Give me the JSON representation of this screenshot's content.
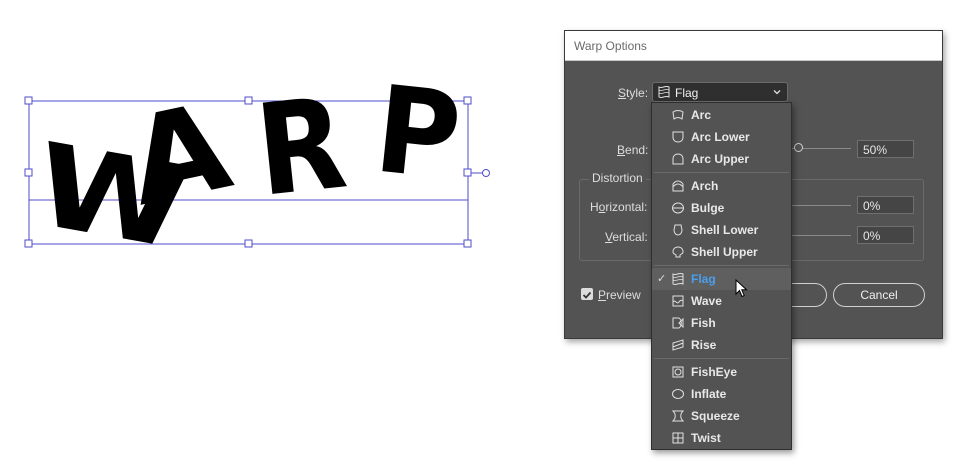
{
  "artwork": {
    "text": "WARP"
  },
  "dialog": {
    "title": "Warp Options",
    "style": {
      "label_prefix": "",
      "label_key": "S",
      "label_rest": "tyle:",
      "selected": "Flag",
      "selected_icon": "flag-style-icon"
    },
    "bend": {
      "label_key": "B",
      "label_rest": "end:",
      "value": "50%",
      "fraction": 0.75
    },
    "distortion": {
      "group_label": "Distortion",
      "horizontal": {
        "label_pre": "H",
        "label_key": "o",
        "label_rest": "rizontal:",
        "value": "0%",
        "fraction": 0.5
      },
      "vertical": {
        "label_pre": "",
        "label_key": "V",
        "label_rest": "ertical:",
        "value": "0%",
        "fraction": 0.5
      }
    },
    "preview": {
      "label_key": "P",
      "label_rest": "review",
      "checked": true
    },
    "buttons": {
      "ok": "",
      "cancel": "Cancel"
    }
  },
  "dropdown": {
    "groups": [
      [
        {
          "label": "Arc",
          "icon": "arc-style-icon"
        },
        {
          "label": "Arc Lower",
          "icon": "arc-lower-style-icon"
        },
        {
          "label": "Arc Upper",
          "icon": "arc-upper-style-icon"
        }
      ],
      [
        {
          "label": "Arch",
          "icon": "arch-style-icon"
        },
        {
          "label": "Bulge",
          "icon": "bulge-style-icon"
        },
        {
          "label": "Shell Lower",
          "icon": "shell-lower-style-icon"
        },
        {
          "label": "Shell Upper",
          "icon": "shell-upper-style-icon"
        }
      ],
      [
        {
          "label": "Flag",
          "icon": "flag-style-icon",
          "selected": true
        },
        {
          "label": "Wave",
          "icon": "wave-style-icon"
        },
        {
          "label": "Fish",
          "icon": "fish-style-icon"
        },
        {
          "label": "Rise",
          "icon": "rise-style-icon"
        }
      ],
      [
        {
          "label": "FishEye",
          "icon": "fisheye-style-icon"
        },
        {
          "label": "Inflate",
          "icon": "inflate-style-icon"
        },
        {
          "label": "Squeeze",
          "icon": "squeeze-style-icon"
        },
        {
          "label": "Twist",
          "icon": "twist-style-icon"
        }
      ]
    ],
    "check_glyph": "✓"
  },
  "colors": {
    "dialog_bg": "#535353",
    "selection": "#1473e6",
    "selected_text": "#4aa0ec"
  }
}
